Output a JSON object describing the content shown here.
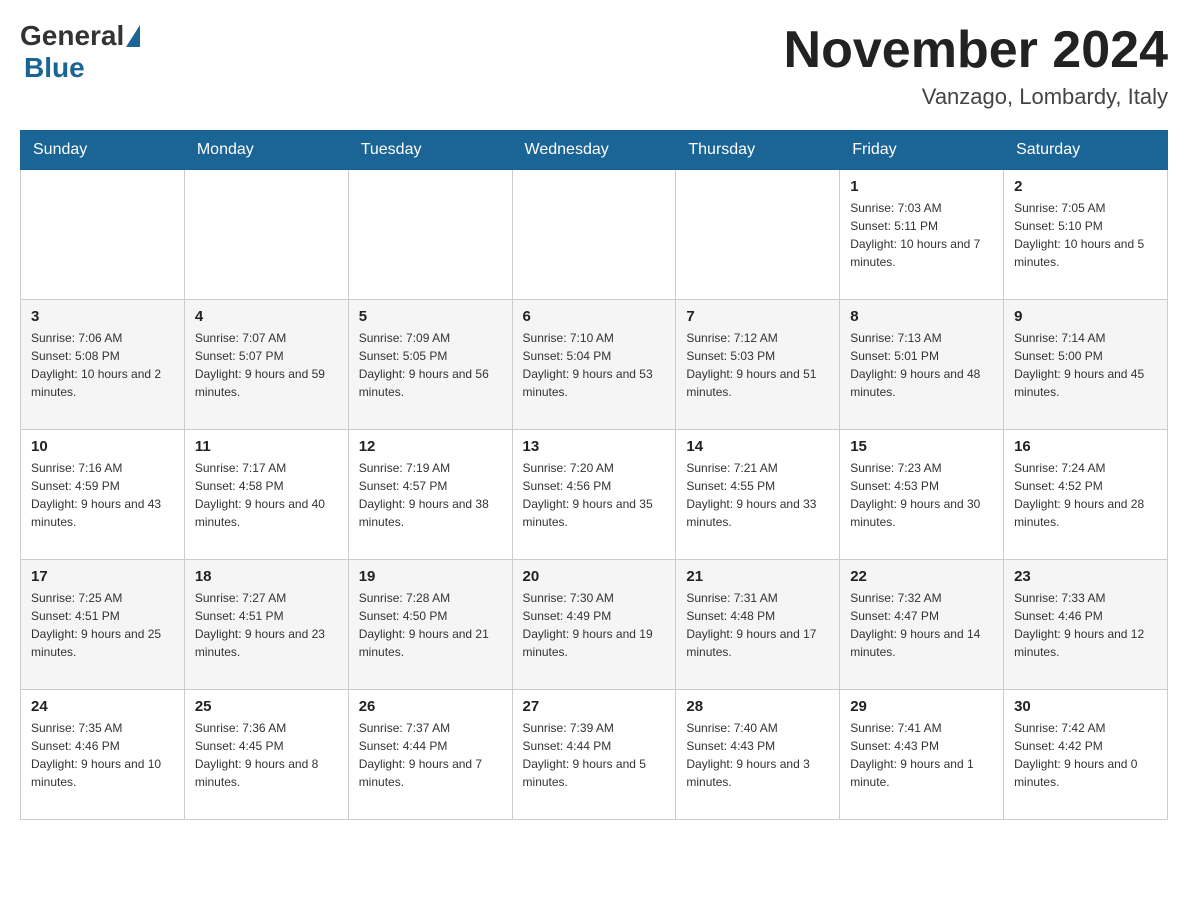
{
  "header": {
    "title": "November 2024",
    "location": "Vanzago, Lombardy, Italy",
    "logo_general": "General",
    "logo_blue": "Blue"
  },
  "weekdays": [
    "Sunday",
    "Monday",
    "Tuesday",
    "Wednesday",
    "Thursday",
    "Friday",
    "Saturday"
  ],
  "weeks": [
    [
      {
        "day": "",
        "info": ""
      },
      {
        "day": "",
        "info": ""
      },
      {
        "day": "",
        "info": ""
      },
      {
        "day": "",
        "info": ""
      },
      {
        "day": "",
        "info": ""
      },
      {
        "day": "1",
        "info": "Sunrise: 7:03 AM\nSunset: 5:11 PM\nDaylight: 10 hours and 7 minutes."
      },
      {
        "day": "2",
        "info": "Sunrise: 7:05 AM\nSunset: 5:10 PM\nDaylight: 10 hours and 5 minutes."
      }
    ],
    [
      {
        "day": "3",
        "info": "Sunrise: 7:06 AM\nSunset: 5:08 PM\nDaylight: 10 hours and 2 minutes."
      },
      {
        "day": "4",
        "info": "Sunrise: 7:07 AM\nSunset: 5:07 PM\nDaylight: 9 hours and 59 minutes."
      },
      {
        "day": "5",
        "info": "Sunrise: 7:09 AM\nSunset: 5:05 PM\nDaylight: 9 hours and 56 minutes."
      },
      {
        "day": "6",
        "info": "Sunrise: 7:10 AM\nSunset: 5:04 PM\nDaylight: 9 hours and 53 minutes."
      },
      {
        "day": "7",
        "info": "Sunrise: 7:12 AM\nSunset: 5:03 PM\nDaylight: 9 hours and 51 minutes."
      },
      {
        "day": "8",
        "info": "Sunrise: 7:13 AM\nSunset: 5:01 PM\nDaylight: 9 hours and 48 minutes."
      },
      {
        "day": "9",
        "info": "Sunrise: 7:14 AM\nSunset: 5:00 PM\nDaylight: 9 hours and 45 minutes."
      }
    ],
    [
      {
        "day": "10",
        "info": "Sunrise: 7:16 AM\nSunset: 4:59 PM\nDaylight: 9 hours and 43 minutes."
      },
      {
        "day": "11",
        "info": "Sunrise: 7:17 AM\nSunset: 4:58 PM\nDaylight: 9 hours and 40 minutes."
      },
      {
        "day": "12",
        "info": "Sunrise: 7:19 AM\nSunset: 4:57 PM\nDaylight: 9 hours and 38 minutes."
      },
      {
        "day": "13",
        "info": "Sunrise: 7:20 AM\nSunset: 4:56 PM\nDaylight: 9 hours and 35 minutes."
      },
      {
        "day": "14",
        "info": "Sunrise: 7:21 AM\nSunset: 4:55 PM\nDaylight: 9 hours and 33 minutes."
      },
      {
        "day": "15",
        "info": "Sunrise: 7:23 AM\nSunset: 4:53 PM\nDaylight: 9 hours and 30 minutes."
      },
      {
        "day": "16",
        "info": "Sunrise: 7:24 AM\nSunset: 4:52 PM\nDaylight: 9 hours and 28 minutes."
      }
    ],
    [
      {
        "day": "17",
        "info": "Sunrise: 7:25 AM\nSunset: 4:51 PM\nDaylight: 9 hours and 25 minutes."
      },
      {
        "day": "18",
        "info": "Sunrise: 7:27 AM\nSunset: 4:51 PM\nDaylight: 9 hours and 23 minutes."
      },
      {
        "day": "19",
        "info": "Sunrise: 7:28 AM\nSunset: 4:50 PM\nDaylight: 9 hours and 21 minutes."
      },
      {
        "day": "20",
        "info": "Sunrise: 7:30 AM\nSunset: 4:49 PM\nDaylight: 9 hours and 19 minutes."
      },
      {
        "day": "21",
        "info": "Sunrise: 7:31 AM\nSunset: 4:48 PM\nDaylight: 9 hours and 17 minutes."
      },
      {
        "day": "22",
        "info": "Sunrise: 7:32 AM\nSunset: 4:47 PM\nDaylight: 9 hours and 14 minutes."
      },
      {
        "day": "23",
        "info": "Sunrise: 7:33 AM\nSunset: 4:46 PM\nDaylight: 9 hours and 12 minutes."
      }
    ],
    [
      {
        "day": "24",
        "info": "Sunrise: 7:35 AM\nSunset: 4:46 PM\nDaylight: 9 hours and 10 minutes."
      },
      {
        "day": "25",
        "info": "Sunrise: 7:36 AM\nSunset: 4:45 PM\nDaylight: 9 hours and 8 minutes."
      },
      {
        "day": "26",
        "info": "Sunrise: 7:37 AM\nSunset: 4:44 PM\nDaylight: 9 hours and 7 minutes."
      },
      {
        "day": "27",
        "info": "Sunrise: 7:39 AM\nSunset: 4:44 PM\nDaylight: 9 hours and 5 minutes."
      },
      {
        "day": "28",
        "info": "Sunrise: 7:40 AM\nSunset: 4:43 PM\nDaylight: 9 hours and 3 minutes."
      },
      {
        "day": "29",
        "info": "Sunrise: 7:41 AM\nSunset: 4:43 PM\nDaylight: 9 hours and 1 minute."
      },
      {
        "day": "30",
        "info": "Sunrise: 7:42 AM\nSunset: 4:42 PM\nDaylight: 9 hours and 0 minutes."
      }
    ]
  ]
}
